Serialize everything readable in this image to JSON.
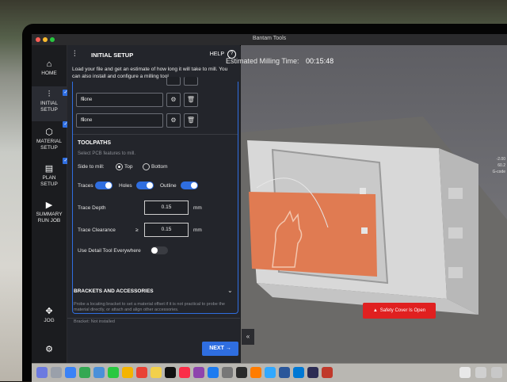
{
  "window": {
    "title": "Bantam Tools"
  },
  "rail": {
    "home": "HOME",
    "initial_setup": [
      "INITIAL",
      "SETUP"
    ],
    "material_setup": [
      "MATERIAL",
      "SETUP"
    ],
    "plan_setup": [
      "PLAN",
      "SETUP"
    ],
    "summary_run_job": [
      "SUMMARY",
      "RUN JOB"
    ],
    "jog": "JOG"
  },
  "panel": {
    "title": "INITIAL SETUP",
    "help": "HELP",
    "intro": "Load your file and get an estimate of how long it will take to mill. You can also install and configure a milling tool.",
    "tools": [
      {
        "value": "None"
      },
      {
        "value": "None"
      }
    ],
    "toolpaths": {
      "heading": "TOOLPATHS",
      "hint": "Select PCB features to mill.",
      "side_label": "Side to mill:",
      "side_options": [
        "Top",
        "Bottom"
      ],
      "side_selected": "Top",
      "toggles": [
        {
          "label": "Traces",
          "on": true
        },
        {
          "label": "Holes",
          "on": true
        },
        {
          "label": "Outline",
          "on": true
        }
      ],
      "trace_depth_label": "Trace Depth",
      "trace_depth_value": "0.15",
      "trace_clearance_label": "Trace Clearance",
      "trace_clearance_op": "≥",
      "trace_clearance_value": "0.15",
      "unit": "mm",
      "detail_tool_label": "Use Detail Tool Everywhere",
      "detail_tool_on": false
    },
    "brackets": {
      "heading": "BRACKETS AND ACCESSORIES",
      "body": "Probe a locating bracket to set a material offset if it is not practical to probe the material directly, or attach and align other accessories.",
      "status": "Bracket: Not installed"
    },
    "next": "NEXT"
  },
  "viewport": {
    "estimate_label": "Estimated Milling Time:",
    "estimate_value": "00:15:48",
    "warning": "Safety Cover Is Open",
    "side_readout": [
      "-2.00",
      "60.2",
      "G-code"
    ]
  },
  "colors": {
    "accent": "#2f6ee0",
    "copper": "#e07b52",
    "warning": "#e02020"
  }
}
